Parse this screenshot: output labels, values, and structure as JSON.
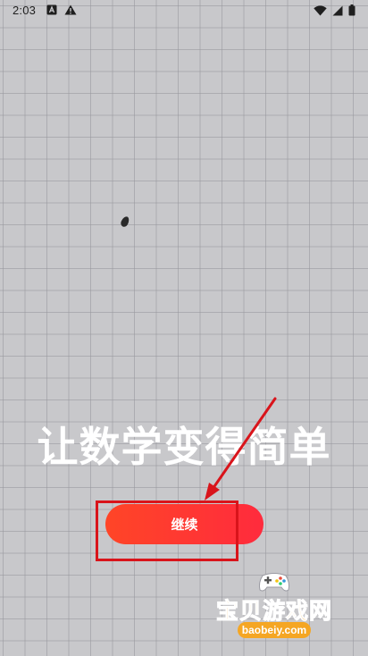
{
  "status_bar": {
    "time": "2:03",
    "icons": [
      "notification-a-icon",
      "warning-icon",
      "wifi-icon",
      "signal-icon",
      "battery-icon"
    ]
  },
  "onboarding": {
    "headline": "让数学变得简单",
    "continue_label": "继续"
  },
  "watermark": {
    "title": "宝贝游戏网",
    "url": "baobeiy.com"
  },
  "colors": {
    "background": "#c8c8cb",
    "button_start": "#ff4527",
    "button_end": "#ff2b3d",
    "annotation_red": "#d9141b",
    "watermark_orange": "#f5a623"
  }
}
